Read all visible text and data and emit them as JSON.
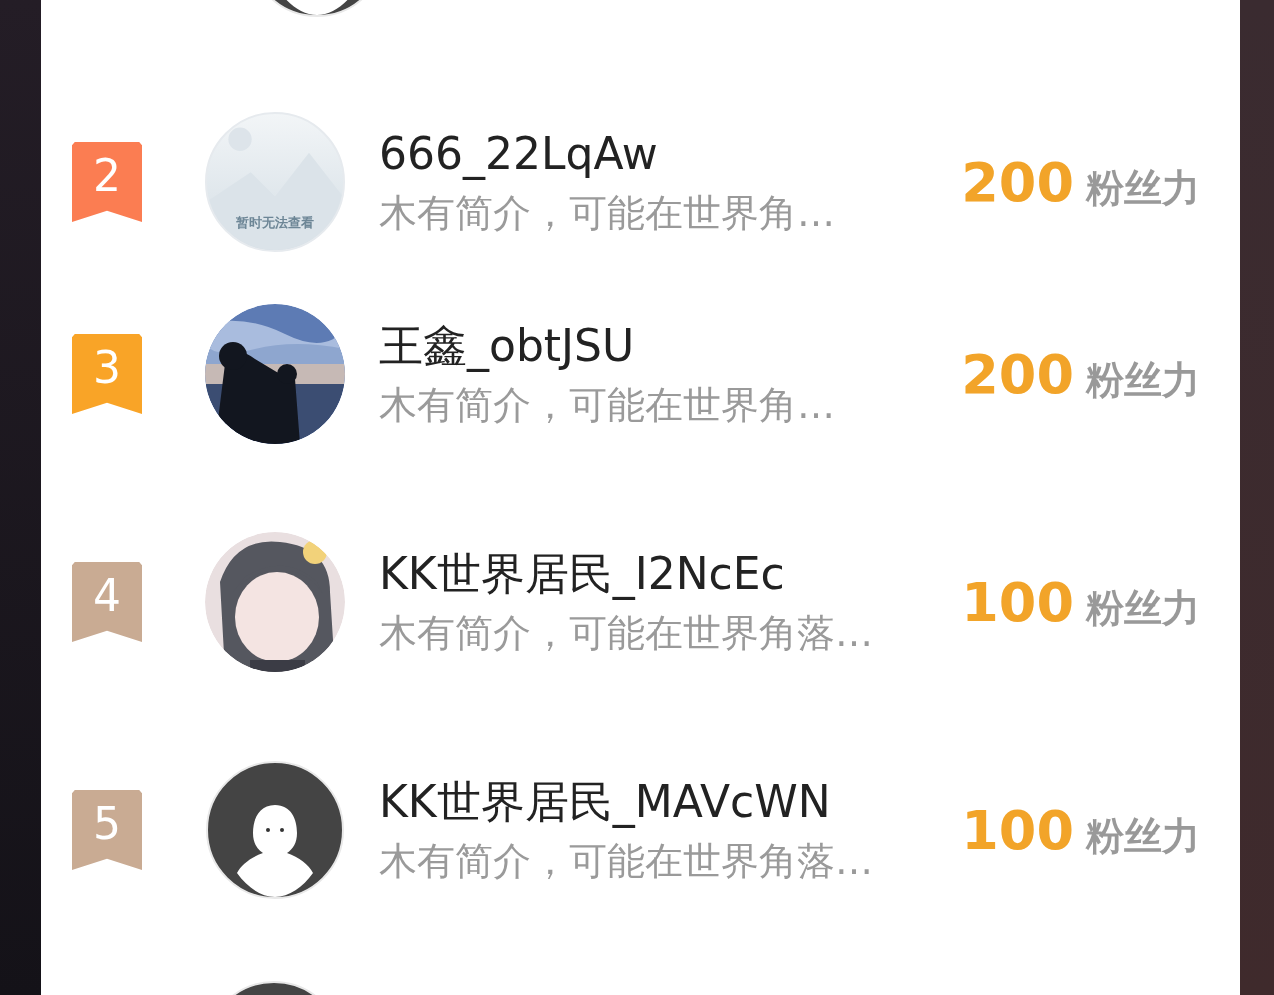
{
  "top_partial_avatar": {
    "kind": "default"
  },
  "bottom_partial_avatar": {
    "kind": "default"
  },
  "rows": [
    {
      "rank": "2",
      "color": "#fb7d52",
      "avatar": {
        "kind": "placeholder",
        "text": "暂时无法查看"
      },
      "name": "666_22LqAw",
      "bio": "木有简介，可能在世界角…",
      "score": "200",
      "unit": "粉丝力"
    },
    {
      "rank": "3",
      "color": "#f9a427",
      "name": "王鑫_obtJSU",
      "bio": "木有简介，可能在世界角…",
      "score": "200",
      "unit": "粉丝力"
    },
    {
      "rank": "4",
      "color": "#c9ab93",
      "name": "KK世界居民_I2NcEc",
      "bio": "木有简介，可能在世界角落…",
      "score": "100",
      "unit": "粉丝力"
    },
    {
      "rank": "5",
      "color": "#c9ab93",
      "avatar": {
        "kind": "default"
      },
      "name": "KK世界居民_MAVcWN",
      "bio": "木有简介，可能在世界角落…",
      "score": "100",
      "unit": "粉丝力"
    }
  ]
}
